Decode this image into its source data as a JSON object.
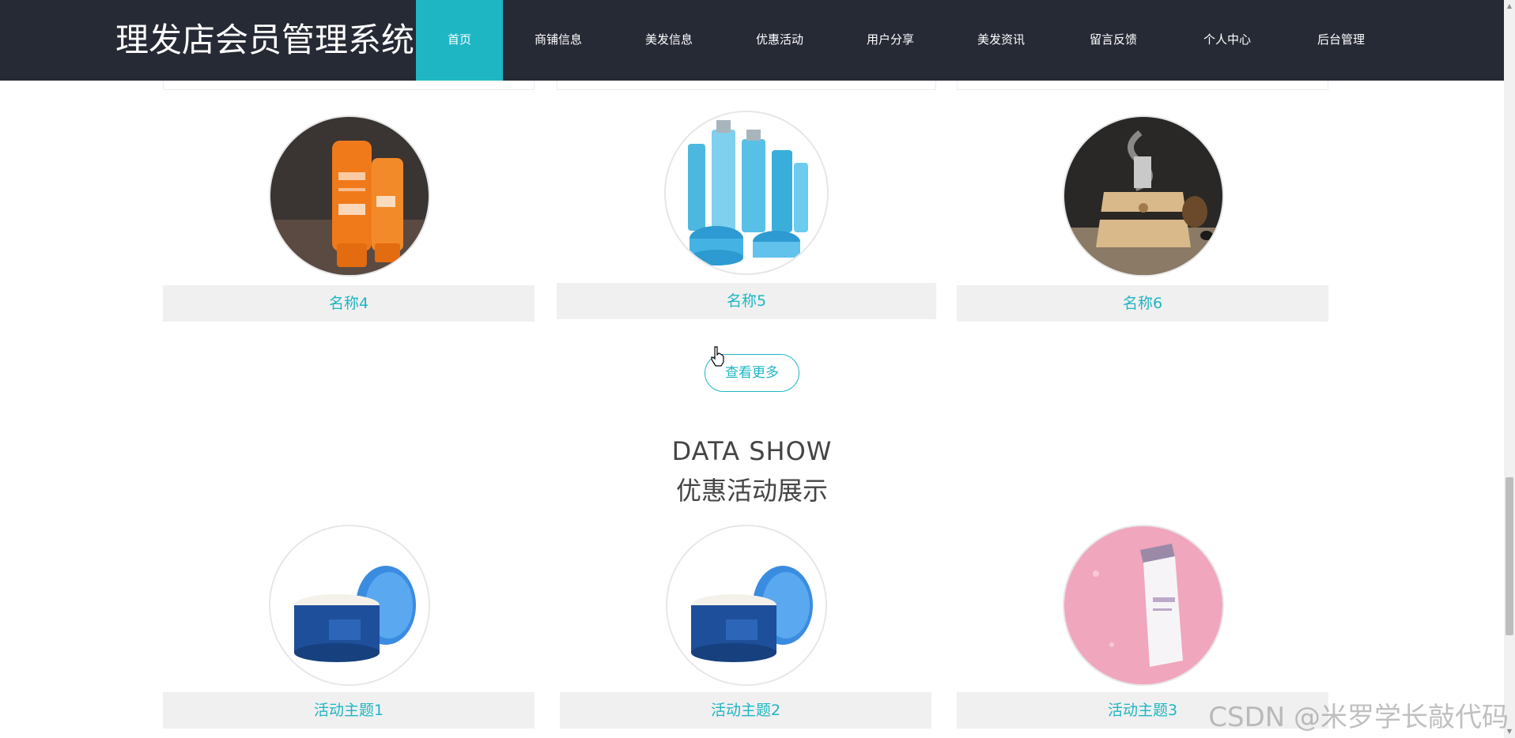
{
  "header": {
    "site_title": "理发店会员管理系统",
    "nav": [
      {
        "label": "首页",
        "active": true
      },
      {
        "label": "商铺信息",
        "active": false
      },
      {
        "label": "美发信息",
        "active": false
      },
      {
        "label": "优惠活动",
        "active": false
      },
      {
        "label": "用户分享",
        "active": false
      },
      {
        "label": "美发资讯",
        "active": false
      },
      {
        "label": "留言反馈",
        "active": false
      },
      {
        "label": "个人中心",
        "active": false
      },
      {
        "label": "后台管理",
        "active": false
      }
    ]
  },
  "products": {
    "items": [
      {
        "name": "名称4",
        "image_icon": "sunscreen-bottles-image"
      },
      {
        "name": "名称5",
        "image_icon": "skincare-set-image"
      },
      {
        "name": "名称6",
        "image_icon": "aroma-diffuser-image"
      }
    ],
    "more_label": "查看更多"
  },
  "promotions": {
    "heading_en": "DATA SHOW",
    "heading_cn": "优惠活动展示",
    "items": [
      {
        "name": "活动主题1",
        "image_icon": "cream-jar-image"
      },
      {
        "name": "活动主题2",
        "image_icon": "cream-jar-image"
      },
      {
        "name": "活动主题3",
        "image_icon": "lotion-bottle-image"
      }
    ]
  },
  "watermark": "CSDN @米罗学长敲代码",
  "colors": {
    "nav_bg": "#262a35",
    "accent": "#1fb6c4",
    "label_bg": "#f0f0f0"
  }
}
